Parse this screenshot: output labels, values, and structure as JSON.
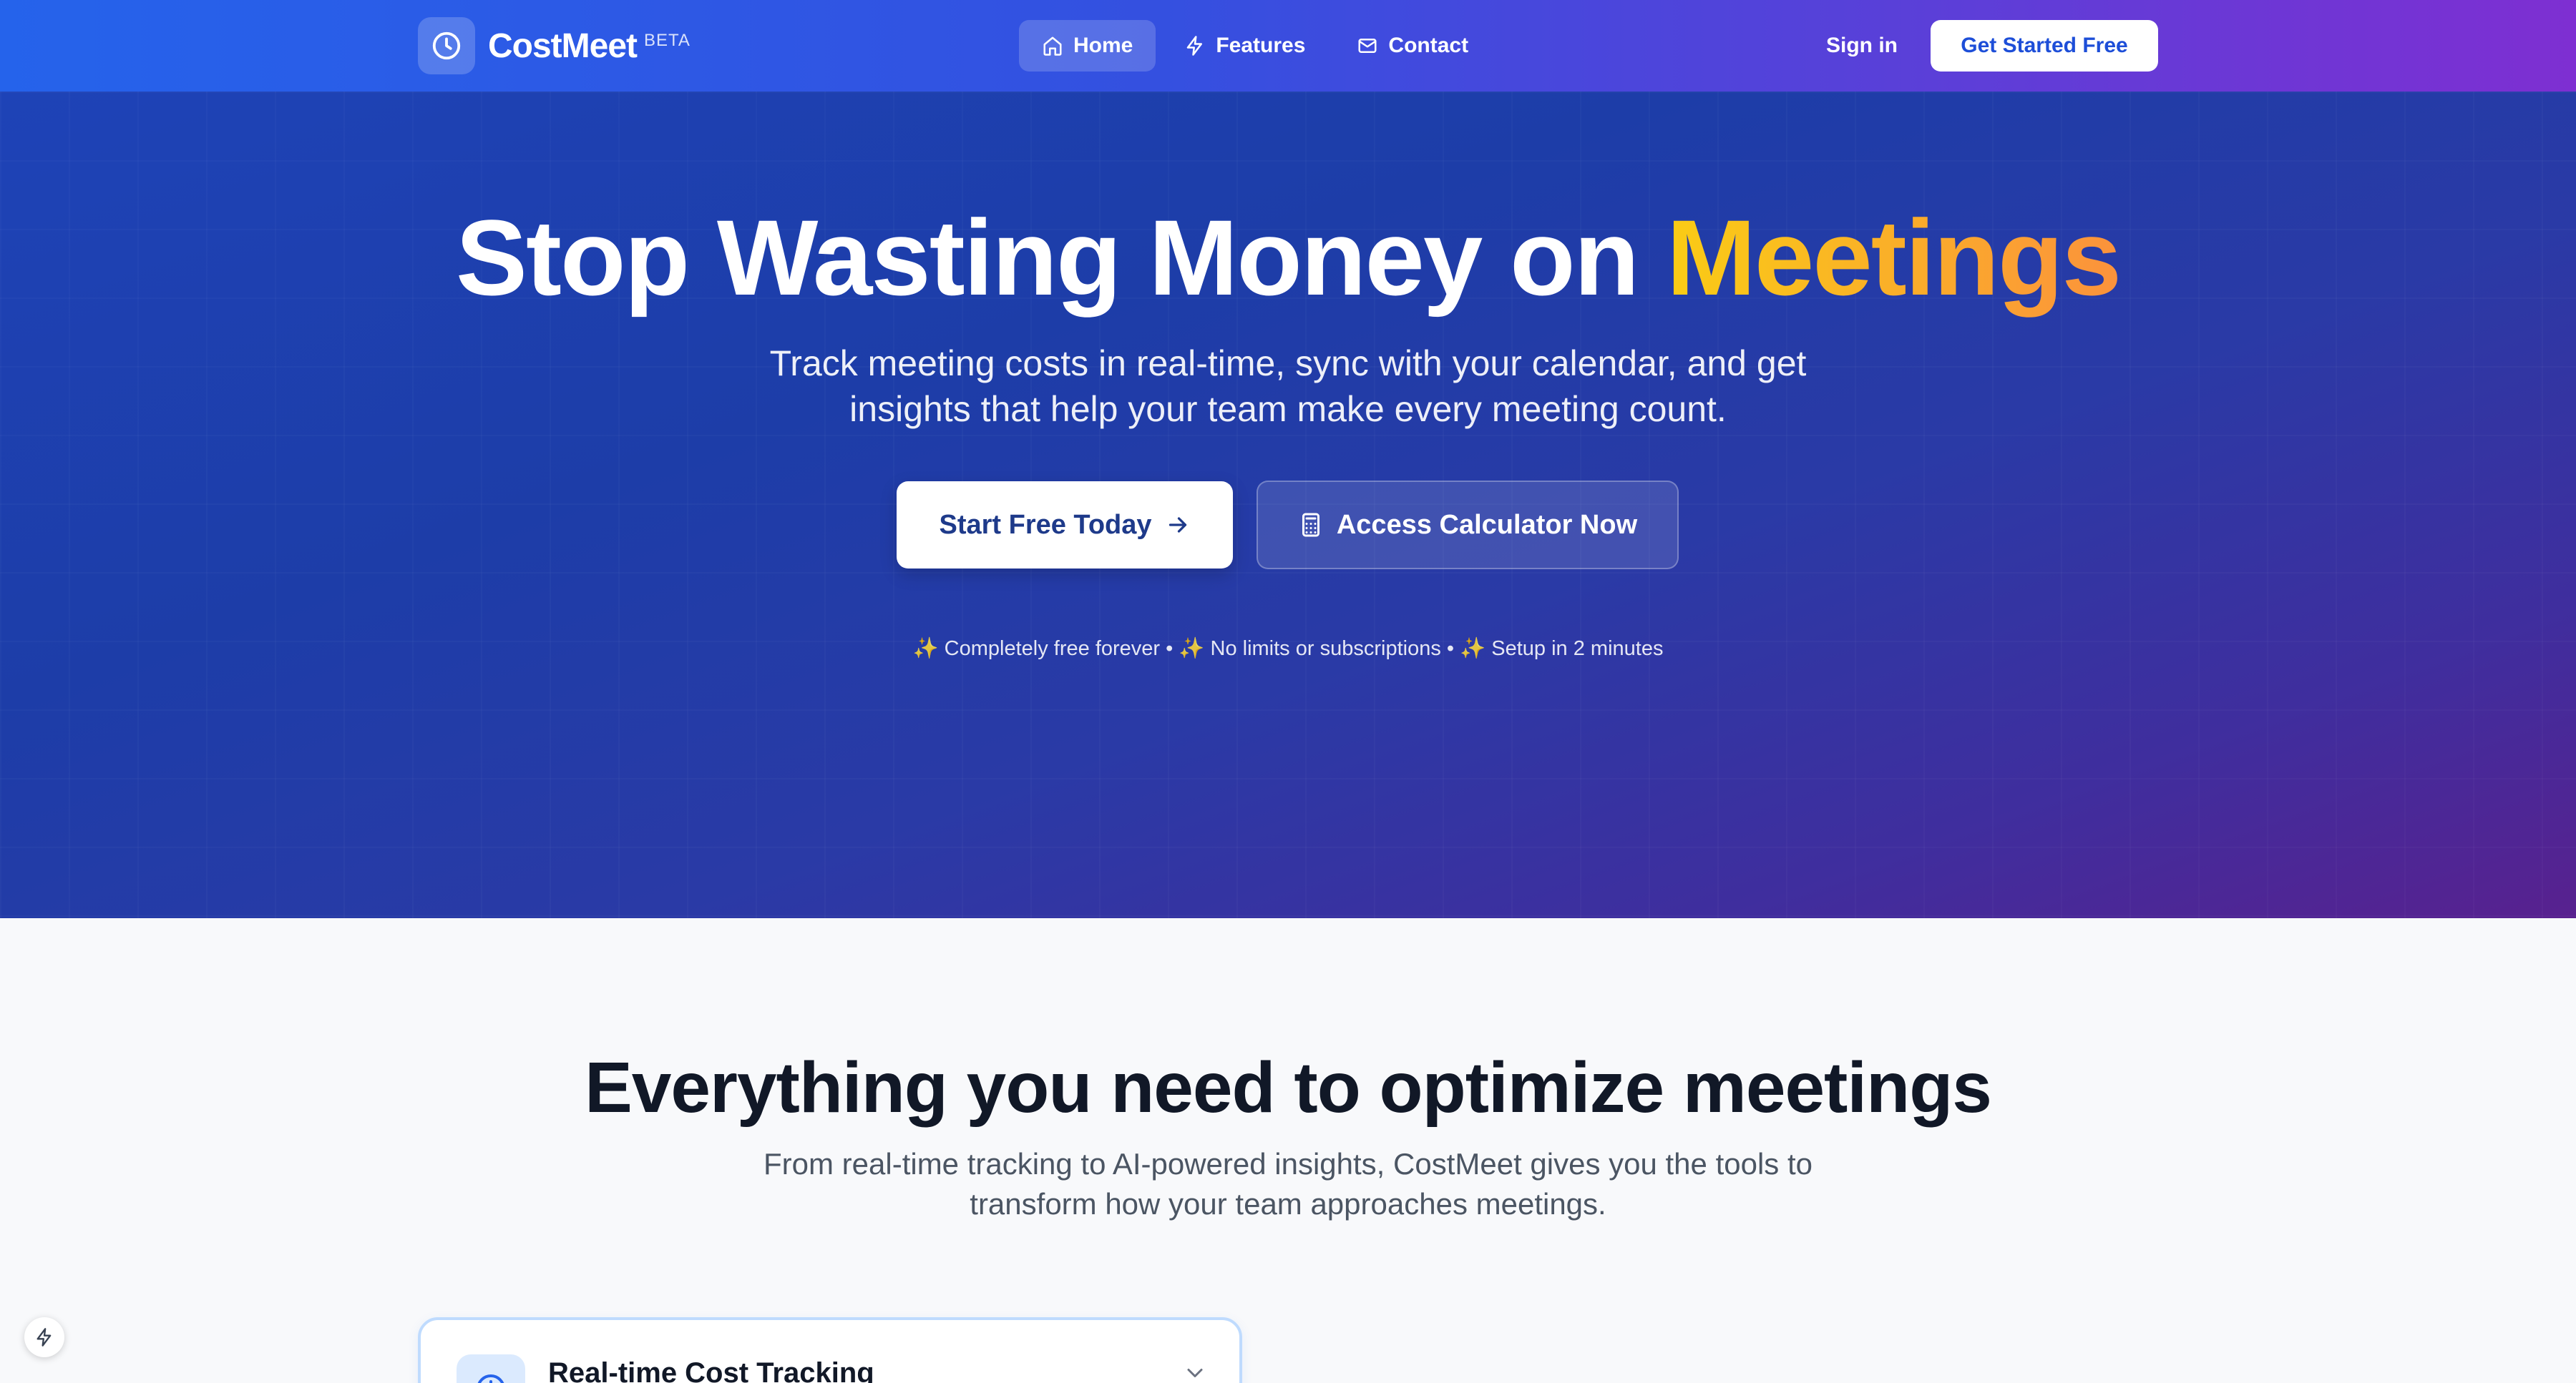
{
  "brand": {
    "name": "CostMeet",
    "badge": "BETA"
  },
  "nav": {
    "links": [
      {
        "label": "Home",
        "icon": "home-icon",
        "active": true
      },
      {
        "label": "Features",
        "icon": "lightning-icon",
        "active": false
      },
      {
        "label": "Contact",
        "icon": "mail-icon",
        "active": false
      }
    ],
    "signin_label": "Sign in",
    "cta_label": "Get Started Free"
  },
  "hero": {
    "title_main": "Stop Wasting Money on",
    "title_accent": "Meetings",
    "subtitle": "Track meeting costs in real-time, sync with your calendar, and get insights that help your team make every meeting count.",
    "primary_button": "Start Free Today",
    "secondary_button": "Access Calculator Now",
    "note": "✨ Completely free forever • ✨ No limits or subscriptions • ✨ Setup in 2 minutes"
  },
  "features": {
    "title": "Everything you need to optimize meetings",
    "subtitle": "From real-time tracking to AI-powered insights, CostMeet gives you the tools to transform how your team approaches meetings.",
    "cards": [
      {
        "title": "Real-time Cost Tracking",
        "icon": "clock-icon"
      }
    ]
  },
  "colors": {
    "nav_start": "#2563eb",
    "nav_end": "#7e2fd2",
    "accent_yellow": "#facc15",
    "accent_orange": "#fb923c",
    "primary_text": "#1e3a8a"
  }
}
